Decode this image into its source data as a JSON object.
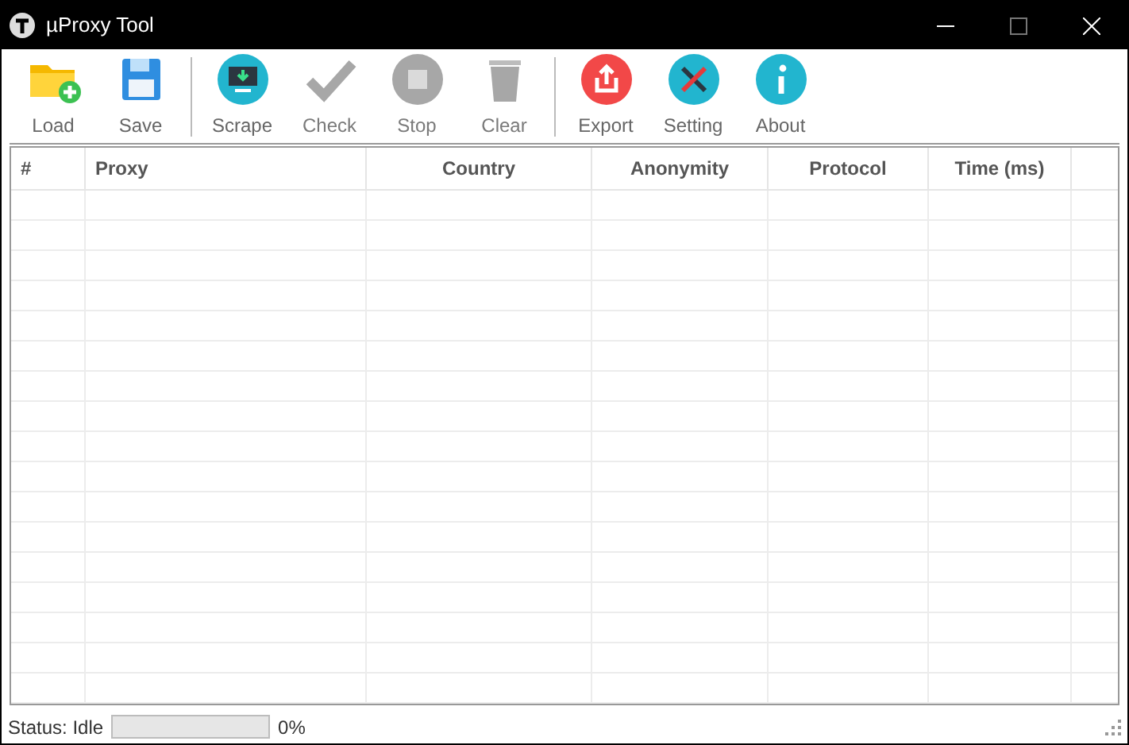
{
  "window": {
    "title": "µProxy Tool"
  },
  "toolbar": {
    "groups": [
      [
        {
          "label": "Load",
          "disabled": false
        },
        {
          "label": "Save",
          "disabled": false
        }
      ],
      [
        {
          "label": "Scrape",
          "disabled": false
        },
        {
          "label": "Check",
          "disabled": true
        },
        {
          "label": "Stop",
          "disabled": true
        },
        {
          "label": "Clear",
          "disabled": true
        }
      ],
      [
        {
          "label": "Export",
          "disabled": false
        },
        {
          "label": "Setting",
          "disabled": false
        },
        {
          "label": "About",
          "disabled": false
        }
      ]
    ]
  },
  "table": {
    "columns": [
      "#",
      "Proxy",
      "Country",
      "Anonymity",
      "Protocol",
      "Time (ms)"
    ]
  },
  "status_bar": {
    "status": "Status: Idle",
    "progress": {
      "level": 0,
      "reading": "0%"
    }
  }
}
